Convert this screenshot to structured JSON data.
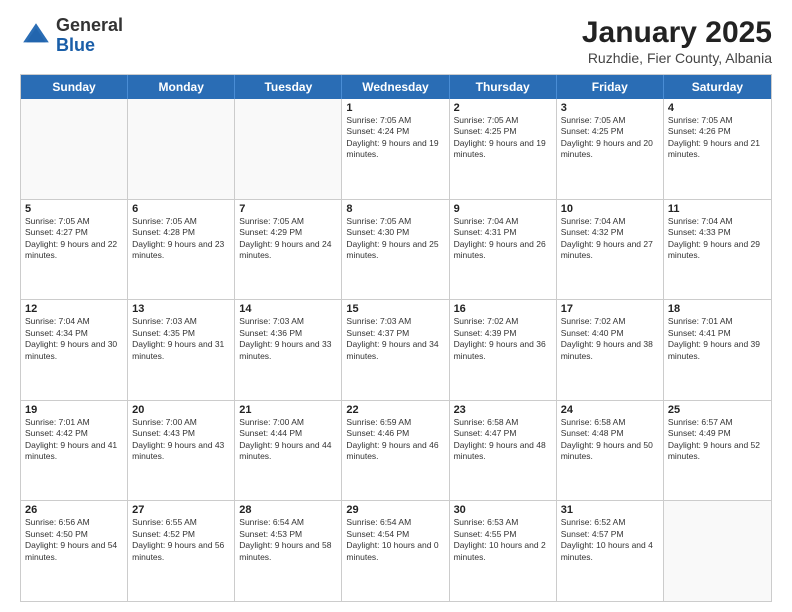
{
  "header": {
    "logo": {
      "general": "General",
      "blue": "Blue"
    },
    "title": "January 2025",
    "subtitle": "Ruzhdie, Fier County, Albania"
  },
  "calendar": {
    "weekdays": [
      "Sunday",
      "Monday",
      "Tuesday",
      "Wednesday",
      "Thursday",
      "Friday",
      "Saturday"
    ],
    "rows": [
      [
        {
          "day": "",
          "empty": true
        },
        {
          "day": "",
          "empty": true
        },
        {
          "day": "",
          "empty": true
        },
        {
          "day": "1",
          "sunrise": "7:05 AM",
          "sunset": "4:24 PM",
          "daylight": "9 hours and 19 minutes."
        },
        {
          "day": "2",
          "sunrise": "7:05 AM",
          "sunset": "4:25 PM",
          "daylight": "9 hours and 19 minutes."
        },
        {
          "day": "3",
          "sunrise": "7:05 AM",
          "sunset": "4:25 PM",
          "daylight": "9 hours and 20 minutes."
        },
        {
          "day": "4",
          "sunrise": "7:05 AM",
          "sunset": "4:26 PM",
          "daylight": "9 hours and 21 minutes."
        }
      ],
      [
        {
          "day": "5",
          "sunrise": "7:05 AM",
          "sunset": "4:27 PM",
          "daylight": "9 hours and 22 minutes."
        },
        {
          "day": "6",
          "sunrise": "7:05 AM",
          "sunset": "4:28 PM",
          "daylight": "9 hours and 23 minutes."
        },
        {
          "day": "7",
          "sunrise": "7:05 AM",
          "sunset": "4:29 PM",
          "daylight": "9 hours and 24 minutes."
        },
        {
          "day": "8",
          "sunrise": "7:05 AM",
          "sunset": "4:30 PM",
          "daylight": "9 hours and 25 minutes."
        },
        {
          "day": "9",
          "sunrise": "7:04 AM",
          "sunset": "4:31 PM",
          "daylight": "9 hours and 26 minutes."
        },
        {
          "day": "10",
          "sunrise": "7:04 AM",
          "sunset": "4:32 PM",
          "daylight": "9 hours and 27 minutes."
        },
        {
          "day": "11",
          "sunrise": "7:04 AM",
          "sunset": "4:33 PM",
          "daylight": "9 hours and 29 minutes."
        }
      ],
      [
        {
          "day": "12",
          "sunrise": "7:04 AM",
          "sunset": "4:34 PM",
          "daylight": "9 hours and 30 minutes."
        },
        {
          "day": "13",
          "sunrise": "7:03 AM",
          "sunset": "4:35 PM",
          "daylight": "9 hours and 31 minutes."
        },
        {
          "day": "14",
          "sunrise": "7:03 AM",
          "sunset": "4:36 PM",
          "daylight": "9 hours and 33 minutes."
        },
        {
          "day": "15",
          "sunrise": "7:03 AM",
          "sunset": "4:37 PM",
          "daylight": "9 hours and 34 minutes."
        },
        {
          "day": "16",
          "sunrise": "7:02 AM",
          "sunset": "4:39 PM",
          "daylight": "9 hours and 36 minutes."
        },
        {
          "day": "17",
          "sunrise": "7:02 AM",
          "sunset": "4:40 PM",
          "daylight": "9 hours and 38 minutes."
        },
        {
          "day": "18",
          "sunrise": "7:01 AM",
          "sunset": "4:41 PM",
          "daylight": "9 hours and 39 minutes."
        }
      ],
      [
        {
          "day": "19",
          "sunrise": "7:01 AM",
          "sunset": "4:42 PM",
          "daylight": "9 hours and 41 minutes."
        },
        {
          "day": "20",
          "sunrise": "7:00 AM",
          "sunset": "4:43 PM",
          "daylight": "9 hours and 43 minutes."
        },
        {
          "day": "21",
          "sunrise": "7:00 AM",
          "sunset": "4:44 PM",
          "daylight": "9 hours and 44 minutes."
        },
        {
          "day": "22",
          "sunrise": "6:59 AM",
          "sunset": "4:46 PM",
          "daylight": "9 hours and 46 minutes."
        },
        {
          "day": "23",
          "sunrise": "6:58 AM",
          "sunset": "4:47 PM",
          "daylight": "9 hours and 48 minutes."
        },
        {
          "day": "24",
          "sunrise": "6:58 AM",
          "sunset": "4:48 PM",
          "daylight": "9 hours and 50 minutes."
        },
        {
          "day": "25",
          "sunrise": "6:57 AM",
          "sunset": "4:49 PM",
          "daylight": "9 hours and 52 minutes."
        }
      ],
      [
        {
          "day": "26",
          "sunrise": "6:56 AM",
          "sunset": "4:50 PM",
          "daylight": "9 hours and 54 minutes."
        },
        {
          "day": "27",
          "sunrise": "6:55 AM",
          "sunset": "4:52 PM",
          "daylight": "9 hours and 56 minutes."
        },
        {
          "day": "28",
          "sunrise": "6:54 AM",
          "sunset": "4:53 PM",
          "daylight": "9 hours and 58 minutes."
        },
        {
          "day": "29",
          "sunrise": "6:54 AM",
          "sunset": "4:54 PM",
          "daylight": "10 hours and 0 minutes."
        },
        {
          "day": "30",
          "sunrise": "6:53 AM",
          "sunset": "4:55 PM",
          "daylight": "10 hours and 2 minutes."
        },
        {
          "day": "31",
          "sunrise": "6:52 AM",
          "sunset": "4:57 PM",
          "daylight": "10 hours and 4 minutes."
        },
        {
          "day": "",
          "empty": true
        }
      ]
    ]
  }
}
